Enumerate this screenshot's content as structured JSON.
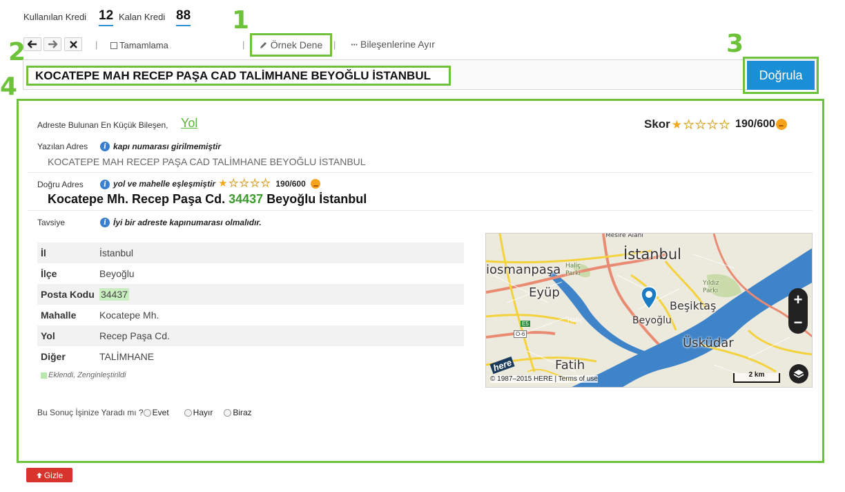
{
  "credits": {
    "used_label": "Kullanılan Kredi",
    "used_value": "12",
    "remaining_label": "Kalan Kredi",
    "remaining_value": "88"
  },
  "toolbar": {
    "back_icon": "arrow-left-icon",
    "forward_icon": "arrow-right-icon",
    "clear_icon": "close-icon",
    "autocomplete_label": "Tamamlama",
    "example_label": "Örnek Dene",
    "split_label": "Bileşenlerine Ayır"
  },
  "callouts": [
    "1",
    "2",
    "3",
    "4"
  ],
  "address": {
    "value": "KOCATEPE MAH RECEP PAŞA CAD TALİMHANE  BEYOĞLU İSTANBUL",
    "verify_label": "Doğrula"
  },
  "result": {
    "smallest_label": "Adreste Bulunan En Küçük Bileşen,",
    "smallest_value": "Yol",
    "score_label": "Skor",
    "score_value": "190/600",
    "rating": 1,
    "rating_max": 5,
    "written": {
      "label": "Yazılan Adres",
      "note": "kapı numarası girilmemiştir",
      "text": "KOCATEPE MAH RECEP PAŞA CAD TALİMHANE BEYOĞLU İSTANBUL"
    },
    "correct": {
      "label": "Doğru Adres",
      "note": "yol ve mahelle eşleşmiştir",
      "score": "190/600",
      "text_before": "Kocatepe Mh. Recep Paşa Cd.",
      "postcode": "34437",
      "text_after": "Beyoğlu İstanbul"
    },
    "advice": {
      "label": "Tavsiye",
      "note": "İyi bir adreste kapınumarası olmalıdır."
    },
    "components": [
      {
        "key": "İl",
        "value": "İstanbul"
      },
      {
        "key": "İlçe",
        "value": "Beyoğlu"
      },
      {
        "key": "Posta Kodu",
        "value": "34437"
      },
      {
        "key": "Mahalle",
        "value": "Kocatepe Mh."
      },
      {
        "key": "Yol",
        "value": "Recep Paşa Cd."
      },
      {
        "key": "Diğer",
        "value": "TALİMHANE"
      }
    ],
    "legend_note": "Eklendi, Zenginleştirildi",
    "feedback": {
      "question": "Bu Sonuç İşinize Yaradı mı ?",
      "options": [
        "Evet",
        "Hayır",
        "Biraz"
      ]
    },
    "hide_label": "Gizle"
  },
  "map": {
    "labels": {
      "istanbul": "İstanbul",
      "gaziosmanpasa": "iosmanpaşa",
      "eyup": "Eyüp",
      "besiktas": "Beşiktaş",
      "beyoglu": "Beyoğlu",
      "uskudar": "Üsküdar",
      "fatih": "Fatih",
      "halic_parki": "Haliç Parkı",
      "halic": "Haliç",
      "yildiz_parki": "Yıldız Parkı",
      "mesire": "Mesire Alanı",
      "e5": "E5",
      "o6": "O-6"
    },
    "logo": "here",
    "copyright": "© 1987–2015 HERE | Terms of use",
    "scale": "2 km",
    "zoom_in": "+",
    "zoom_out": "−",
    "colors": {
      "water": "#3f84c9",
      "land": "#ece9dd",
      "major_road": "#f4d23c",
      "highway": "#e98a73"
    }
  }
}
